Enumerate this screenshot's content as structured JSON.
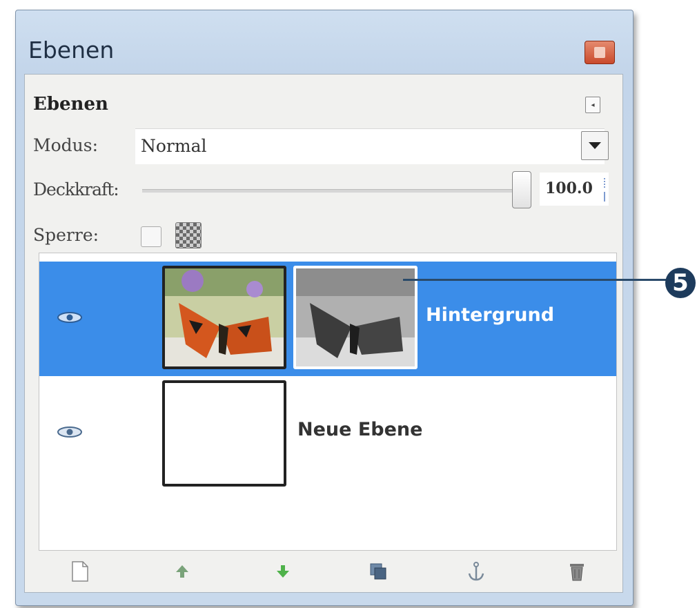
{
  "window": {
    "title": "Ebenen"
  },
  "panel": {
    "heading": "Ebenen",
    "mode_label": "Modus:",
    "mode_value": "Normal",
    "opacity_label": "Deckkraft:",
    "opacity_value": "100.0",
    "lock_label": "Sperre:"
  },
  "layers": [
    {
      "name": "Hintergrund",
      "selected": true,
      "has_mask": true,
      "visible": true
    },
    {
      "name": "Neue Ebene",
      "selected": false,
      "has_mask": false,
      "visible": true
    }
  ],
  "toolbar": {
    "icons": [
      "new-layer-icon",
      "raise-layer-icon",
      "lower-layer-icon",
      "duplicate-layer-icon",
      "anchor-icon",
      "delete-layer-icon"
    ]
  },
  "callout": {
    "number": "5"
  },
  "colors": {
    "selection": "#3b8de9",
    "callout": "#1d3b5c"
  }
}
